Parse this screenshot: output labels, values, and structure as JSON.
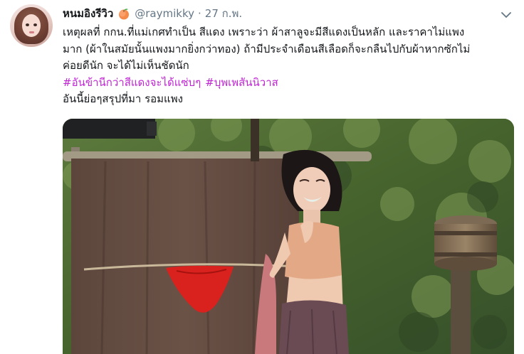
{
  "tweet": {
    "display_name": "หนมอิงรีวิว",
    "name_emoji": "peach-icon",
    "handle": "@raymikky",
    "separator": "·",
    "date": "27 ก.พ.",
    "lines": [
      "เหตุผลที่ กกน.ที่แม่เกศทำเป็น สีแดง เพราะว่า ผ้าสาลูจะมีสีแดงเป็นหลัก และราคาไม่แพง",
      "มาก (ผ้าในสมัยนั้นแพงมากยิ่งกว่าทอง) ถ้ามีประจำเดือนสีเลือดก็จะกลืนไปกับผ้าหากซักไม่",
      "ค่อยดีนัก จะได้ไม่เห็นชัดนัก"
    ],
    "hashtags": [
      "#อันข้านีกว่าสีแดงจะได้แซ่บๆ",
      "#บุพเพสันนิวาส"
    ],
    "closing_line": "อันนี้ย่อๆสรุปที่มา รอมแพง"
  },
  "colors": {
    "hashtag": "#c026d3",
    "secondary_text": "#657786",
    "primary_text": "#14171a"
  }
}
